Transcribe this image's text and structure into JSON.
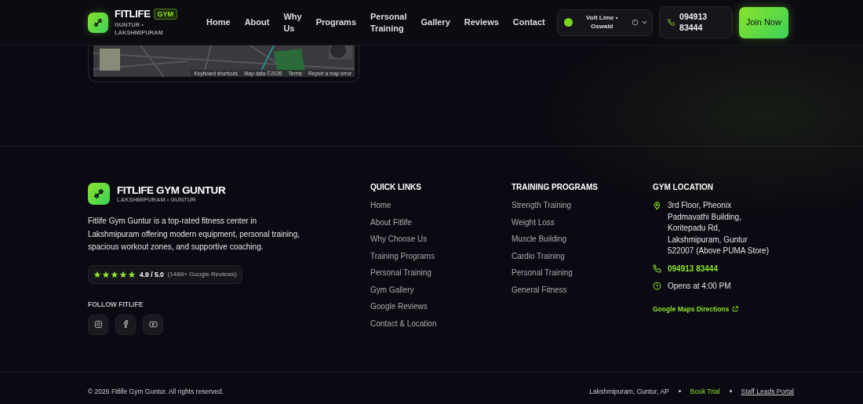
{
  "header": {
    "brand": "FITLIFE",
    "badge": "GYM",
    "tagline": "GUNTUR • LAKSHMIPURAM",
    "nav": [
      {
        "label": "Home"
      },
      {
        "label": "About"
      },
      {
        "label": "Why Us"
      },
      {
        "label": "Programs"
      },
      {
        "label": "Personal Training"
      },
      {
        "label": "Gallery"
      },
      {
        "label": "Reviews"
      },
      {
        "label": "Contact"
      }
    ],
    "theme": {
      "label": "Volt Lime • Oswald",
      "color": "#7ed321"
    },
    "phone": "094913 83444",
    "cta": "Join Now"
  },
  "map": {
    "attribution": [
      "Keyboard shortcuts",
      "Map data ©2026",
      "Terms",
      "Report a map error"
    ]
  },
  "footer": {
    "brand": {
      "name": "FITLIFE GYM GUNTUR",
      "subtitle": "LAKSHMIPURAM • GUNTUR",
      "description": "Fitlife Gym Guntur is a top-rated fitness center in Lakshmipuram offering modern equipment, personal training, spacious workout zones, and supportive coaching.",
      "rating": {
        "stars": 5,
        "score": "4.9 / 5.0",
        "reviews": "(1488+ Google Reviews)"
      },
      "follow_title": "FOLLOW FITLIFE",
      "social": [
        {
          "kind": "instagram"
        },
        {
          "kind": "facebook"
        },
        {
          "kind": "youtube"
        }
      ]
    },
    "quick_links": {
      "title": "QUICK LINKS",
      "items": [
        "Home",
        "About Fitlife",
        "Why Choose Us",
        "Training Programs",
        "Personal Training",
        "Gym Gallery",
        "Google Reviews",
        "Contact & Location"
      ]
    },
    "programs": {
      "title": "TRAINING PROGRAMS",
      "items": [
        "Strength Training",
        "Weight Loss",
        "Muscle Building",
        "Cardio Training",
        "Personal Training",
        "General Fitness"
      ]
    },
    "location": {
      "title": "GYM LOCATION",
      "address": "3rd Floor, Pheonix Padmavathi Building, Koritepadu Rd, Lakshmipuram, Guntur 522007 (Above PUMA Store)",
      "phone": "094913 83444",
      "hours": "Opens at 4:00 PM",
      "directions": "Google Maps Directions"
    }
  },
  "bottom_bar": {
    "copyright": "© 2026 Fitlife Gym Guntur. All rights reserved.",
    "location": "Lakshmipuram, Guntur, AP",
    "links": [
      {
        "label": "Book Trial",
        "kind": "accent"
      },
      {
        "label": "Staff Leads Portal",
        "kind": "underline"
      }
    ]
  }
}
